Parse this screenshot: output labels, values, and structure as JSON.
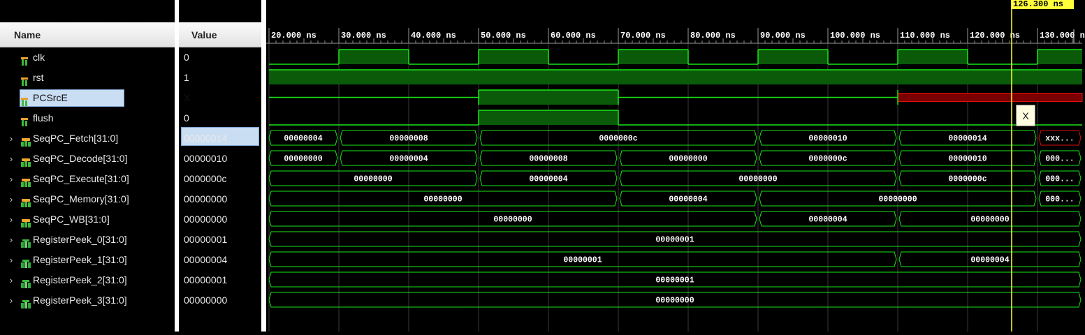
{
  "columns": {
    "name": "Name",
    "value": "Value"
  },
  "signals": [
    {
      "name": "clk",
      "value": "0",
      "kind": "bit",
      "icon": "wire-bit-icon",
      "expandable": false,
      "selected": false
    },
    {
      "name": "rst",
      "value": "1",
      "kind": "bit",
      "icon": "wire-bit-icon",
      "expandable": false,
      "selected": false
    },
    {
      "name": "PCSrcE",
      "value": "X",
      "kind": "bit",
      "icon": "wire-bit-icon",
      "expandable": false,
      "selected": true
    },
    {
      "name": "flush",
      "value": "0",
      "kind": "bit",
      "icon": "wire-bit-icon",
      "expandable": false,
      "selected": false
    },
    {
      "name": "SeqPC_Fetch[31:0]",
      "value": "00000014",
      "kind": "bus",
      "icon": "bus-icon",
      "expandable": true,
      "selected": false
    },
    {
      "name": "SeqPC_Decode[31:0]",
      "value": "00000010",
      "kind": "bus",
      "icon": "bus-icon",
      "expandable": true,
      "selected": false
    },
    {
      "name": "SeqPC_Execute[31:0]",
      "value": "0000000c",
      "kind": "bus",
      "icon": "bus-icon",
      "expandable": true,
      "selected": false
    },
    {
      "name": "SeqPC_Memory[31:0]",
      "value": "00000000",
      "kind": "bus",
      "icon": "bus-icon",
      "expandable": true,
      "selected": false
    },
    {
      "name": "SeqPC_WB[31:0]",
      "value": "00000000",
      "kind": "bus",
      "icon": "bus-icon",
      "expandable": true,
      "selected": false
    },
    {
      "name": "RegisterPeek_0[31:0]",
      "value": "00000001",
      "kind": "bus",
      "icon": "register-bus-icon",
      "expandable": true,
      "selected": false
    },
    {
      "name": "RegisterPeek_1[31:0]",
      "value": "00000004",
      "kind": "bus",
      "icon": "register-bus-icon",
      "expandable": true,
      "selected": false
    },
    {
      "name": "RegisterPeek_2[31:0]",
      "value": "00000001",
      "kind": "bus",
      "icon": "register-bus-icon",
      "expandable": true,
      "selected": false
    },
    {
      "name": "RegisterPeek_3[31:0]",
      "value": "00000000",
      "kind": "bus",
      "icon": "register-bus-icon",
      "expandable": true,
      "selected": false
    }
  ],
  "timeline": {
    "unit": "ns",
    "ticks": [
      "20.000 ns",
      "30.000 ns",
      "40.000 ns",
      "50.000 ns",
      "60.000 ns",
      "70.000 ns",
      "80.000 ns",
      "90.000 ns",
      "100.000 ns",
      "110.000 ns",
      "120.000 ns",
      "130.000 ns"
    ],
    "tick_times": [
      20,
      30,
      40,
      50,
      60,
      70,
      80,
      90,
      100,
      110,
      120,
      130
    ],
    "view_start_ns": 20,
    "view_end_ns": 136.7
  },
  "cursor": {
    "label": "126.300 ns",
    "time_ns": 126.3,
    "color": "#ffff3c"
  },
  "tooltip": {
    "text": "X"
  },
  "waves": {
    "clk": [
      [
        20,
        0
      ],
      [
        30,
        1
      ],
      [
        40,
        0
      ],
      [
        50,
        1
      ],
      [
        60,
        0
      ],
      [
        70,
        1
      ],
      [
        80,
        0
      ],
      [
        90,
        1
      ],
      [
        100,
        0
      ],
      [
        110,
        1
      ],
      [
        120,
        0
      ],
      [
        130,
        1
      ]
    ],
    "rst": [
      [
        20,
        1
      ]
    ],
    "PCSrcE": [
      [
        20,
        "Z"
      ],
      [
        50,
        1
      ],
      [
        70,
        "Z"
      ],
      [
        110,
        "X"
      ]
    ],
    "flush": [
      [
        20,
        0
      ],
      [
        50,
        1
      ],
      [
        70,
        0
      ]
    ],
    "SeqPC_Fetch[31:0]": [
      [
        20,
        "00000004"
      ],
      [
        30,
        "00000008"
      ],
      [
        50,
        "0000000c"
      ],
      [
        90,
        "00000010"
      ],
      [
        110,
        "00000014"
      ],
      [
        130,
        "xxx..."
      ]
    ],
    "SeqPC_Decode[31:0]": [
      [
        20,
        "00000000"
      ],
      [
        30,
        "00000004"
      ],
      [
        50,
        "00000008"
      ],
      [
        70,
        "00000000"
      ],
      [
        90,
        "0000000c"
      ],
      [
        110,
        "00000010"
      ],
      [
        130,
        "000..."
      ]
    ],
    "SeqPC_Execute[31:0]": [
      [
        20,
        "00000000"
      ],
      [
        50,
        "00000004"
      ],
      [
        70,
        "00000000"
      ],
      [
        110,
        "0000000c"
      ],
      [
        130,
        "000..."
      ]
    ],
    "SeqPC_Memory[31:0]": [
      [
        20,
        "00000000"
      ],
      [
        70,
        "00000004"
      ],
      [
        90,
        "00000000"
      ],
      [
        130,
        "000..."
      ]
    ],
    "SeqPC_WB[31:0]": [
      [
        20,
        "00000000"
      ],
      [
        90,
        "00000004"
      ],
      [
        110,
        "00000000"
      ]
    ],
    "RegisterPeek_0[31:0]": [
      [
        20,
        "00000001"
      ]
    ],
    "RegisterPeek_1[31:0]": [
      [
        20,
        "00000001"
      ],
      [
        110,
        "00000004"
      ]
    ],
    "RegisterPeek_2[31:0]": [
      [
        20,
        "00000001"
      ]
    ],
    "RegisterPeek_3[31:0]": [
      [
        20,
        "00000000"
      ]
    ]
  },
  "colors": {
    "wave": "#19e619",
    "wave_fill": "#0a5a0a",
    "x_value": "#e01010",
    "x_fill": "#7a0000",
    "grid": "#3a3a3a",
    "background": "#000000"
  }
}
